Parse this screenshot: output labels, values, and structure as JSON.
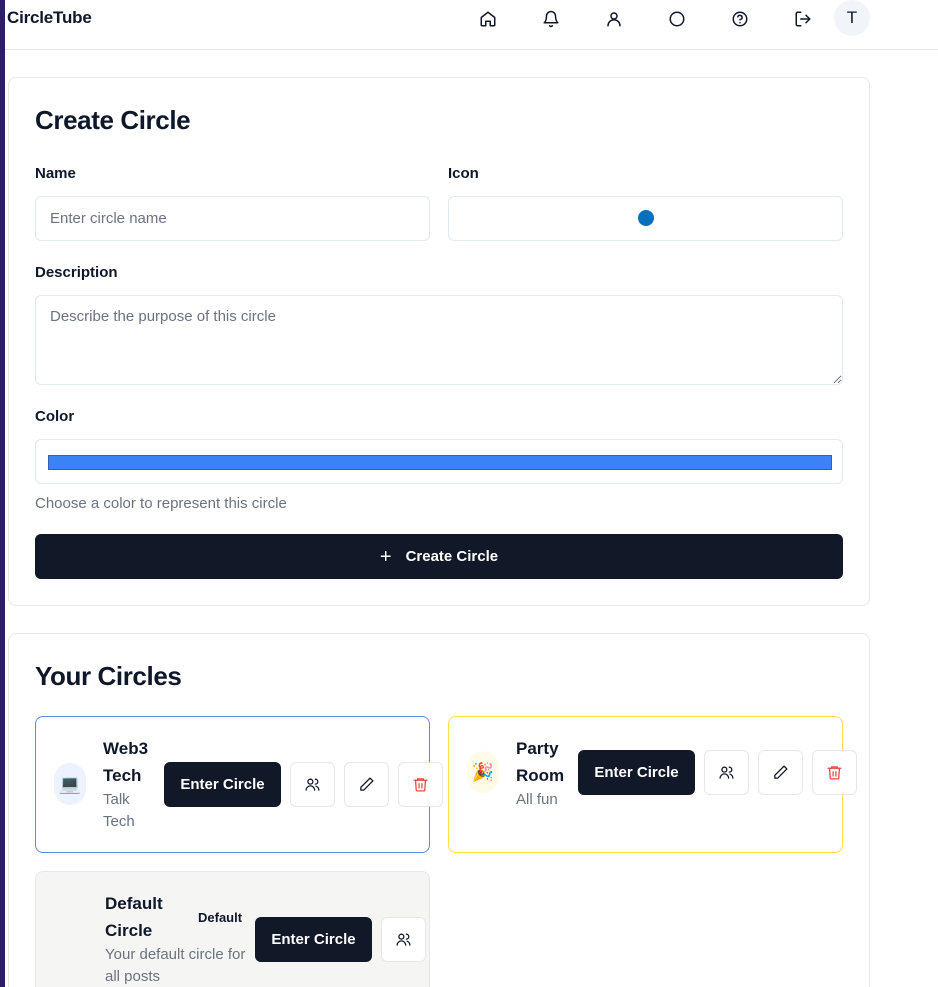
{
  "app": {
    "brand": "CircleTube",
    "nav_icons": [
      "home-icon",
      "bell-icon",
      "user-icon",
      "circle-icon",
      "help-icon",
      "logout-icon"
    ],
    "avatar_initial": "T"
  },
  "create_form": {
    "title": "Create Circle",
    "name_label": "Name",
    "name_placeholder": "Enter circle name",
    "name_value": "",
    "icon_label": "Icon",
    "icon_value_color": "#0770bd",
    "description_label": "Description",
    "description_placeholder": "Describe the purpose of this circle",
    "description_value": "",
    "color_label": "Color",
    "color_value": "#3b82f6",
    "color_helper": "Choose a color to represent this circle",
    "submit_label": "Create Circle"
  },
  "circles_section": {
    "title": "Your Circles",
    "circles": [
      {
        "name_line1": "Web3",
        "name_line2": "Tech",
        "desc_line1": "Talk",
        "desc_line2": "Tech",
        "icon": "💻",
        "border_color": "#5b8def",
        "enter_label": "Enter Circle"
      },
      {
        "name_line1": "Party",
        "name_line2": "Room",
        "desc_line1": "All fun",
        "icon": "🎉",
        "border_color": "#fde047",
        "enter_label": "Enter Circle"
      },
      {
        "name_line1": "Default",
        "name_line2": "Circle",
        "badge": "Default",
        "desc_line1": "Your default circle for",
        "desc_line2": "all posts",
        "enter_label": "Enter Circle"
      }
    ]
  }
}
